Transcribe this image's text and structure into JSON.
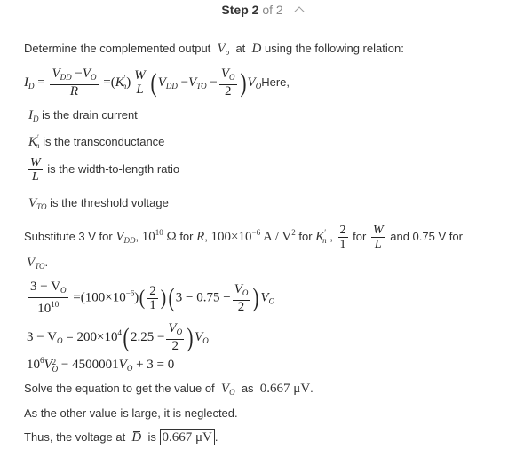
{
  "header": {
    "step_word": "Step",
    "step_current": "2",
    "step_of": "of 2",
    "toggle_icon": "chevron-up-icon"
  },
  "intro": {
    "text_before": "Determine the complemented output",
    "var_v": "V",
    "var_o": "o",
    "text_at": "at",
    "d_bar": "D",
    "text_after": "using the following relation:"
  },
  "relation": {
    "lhs_var": "I",
    "lhs_sub": "D",
    "eq": "=",
    "frac1_num_a": "V",
    "frac1_num_a_sub": "DD",
    "frac1_num_minus": "−",
    "frac1_num_b": "V",
    "frac1_num_b_sub": "O",
    "frac1_den": "R",
    "eq2": "=",
    "k_open": "(",
    "k_var": "K",
    "k_prime": "′",
    "k_sub": "n",
    "k_close": ")",
    "wl_num": "W",
    "wl_den": "L",
    "open_paren": "(",
    "term1": "V",
    "term1_sub": "DD",
    "minus1": "−",
    "term2": "V",
    "term2_sub": "TO",
    "minus2": "−",
    "frac2_num": "V",
    "frac2_num_sub": "O",
    "frac2_den": "2",
    "close_paren": ")",
    "tail_var": "V",
    "tail_sub": "O",
    "here": "Here,"
  },
  "definitions": [
    {
      "sym": "I",
      "sub": "D",
      "text": "is the drain current"
    },
    {
      "sym": "K",
      "prime": "′",
      "sub": "n",
      "text": "is the transconductance"
    },
    {
      "num": "W",
      "den": "L",
      "text": "is the width-to-length ratio"
    },
    {
      "sym": "V",
      "sub": "TO",
      "text": "is the threshold voltage"
    }
  ],
  "substitute": {
    "t1": "Substitute 3 V for",
    "v_dd": "V",
    "v_dd_sub": "DD",
    "sep1": ",",
    "r_val": "10",
    "r_exp": "10",
    "r_unit": "Ω",
    "t2": "for",
    "r_var": "R",
    "sep2": ",",
    "k_val": "100×10",
    "k_exp": "−6",
    "k_unit": "A / V",
    "k_unit_exp": "2",
    "t3": "for",
    "k_var": "K",
    "k_prime": "′",
    "k_sub": "n",
    "sep3": ",",
    "ratio_num": "2",
    "ratio_den": "1",
    "t4": "for",
    "wl_num": "W",
    "wl_den": "L",
    "t5": "and 0.75 V for",
    "vto": "V",
    "vto_sub": "TO",
    "end": "."
  },
  "eq1": {
    "num": "3 − V",
    "num_sub": "O",
    "den": "10",
    "den_exp": "10",
    "eq": "=",
    "p1": "(100×10",
    "p1_exp": "−6",
    "p1_close": ")",
    "ratio_num": "2",
    "ratio_den": "1",
    "p3": "3 − 0.75 −",
    "fnum": "V",
    "fnum_sub": "O",
    "fden": "2",
    "tail": "V",
    "tail_sub": "O"
  },
  "eq2": {
    "lhs": "3 − V",
    "lhs_sub": "O",
    "rhs": "= 200×10",
    "rhs_exp": "4",
    "inner": "2.25 −",
    "fnum": "V",
    "fnum_sub": "O",
    "fden": "2",
    "tail": "V",
    "tail_sub": "O"
  },
  "eq3": {
    "a": "10",
    "a_exp": "6",
    "v": "V",
    "v_exp": "2",
    "v_sub": "O",
    "mid": "− 4500001",
    "v2": "V",
    "v2_sub": "O",
    "end": "+ 3 = 0"
  },
  "solve": {
    "t1": "Solve the equation to get the value of",
    "var": "V",
    "var_sub": "O",
    "t2": "as",
    "value": "0.667 μV",
    "end": "."
  },
  "neglect": {
    "text": "As the other value is large, it is neglected."
  },
  "answer": {
    "t1": "Thus, the voltage at",
    "d_bar": "D",
    "t2": "is",
    "value": "0.667 μV",
    "end": "."
  }
}
